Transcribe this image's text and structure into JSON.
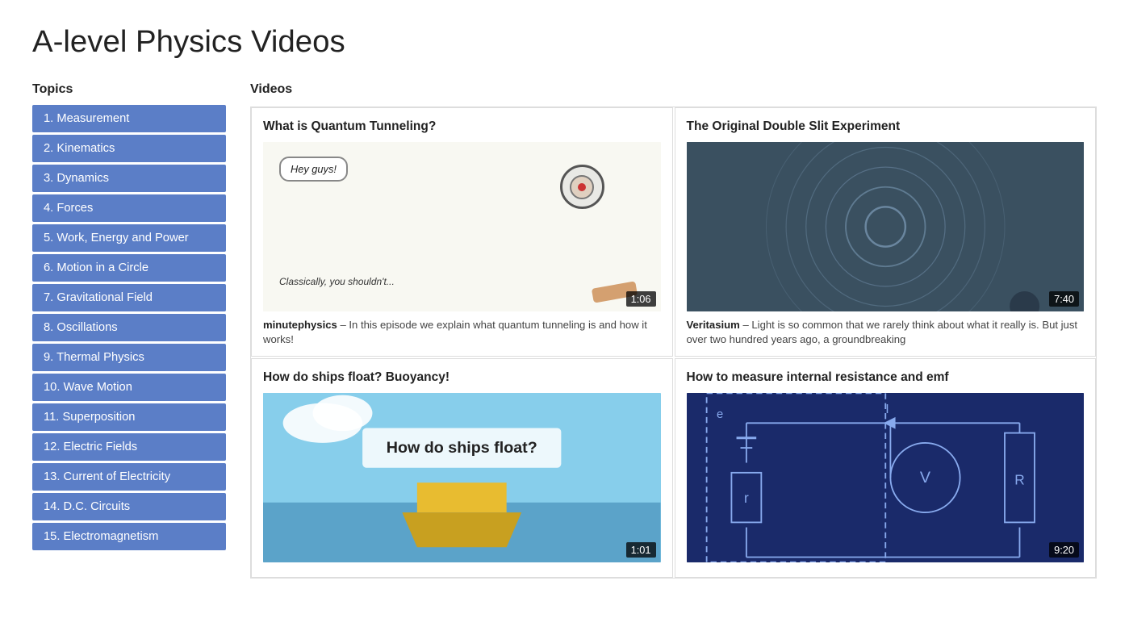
{
  "page": {
    "title": "A-level Physics Videos"
  },
  "sidebar": {
    "title": "Topics",
    "items": [
      {
        "id": "1",
        "label": "1. Measurement"
      },
      {
        "id": "2",
        "label": "2. Kinematics"
      },
      {
        "id": "3",
        "label": "3. Dynamics"
      },
      {
        "id": "4",
        "label": "4. Forces"
      },
      {
        "id": "5",
        "label": "5. Work, Energy and Power"
      },
      {
        "id": "6",
        "label": "6. Motion in a Circle"
      },
      {
        "id": "7",
        "label": "7. Gravitational Field"
      },
      {
        "id": "8",
        "label": "8. Oscillations"
      },
      {
        "id": "9",
        "label": "9. Thermal Physics"
      },
      {
        "id": "10",
        "label": "10. Wave Motion"
      },
      {
        "id": "11",
        "label": "11. Superposition"
      },
      {
        "id": "12",
        "label": "12. Electric Fields"
      },
      {
        "id": "13",
        "label": "13. Current of Electricity"
      },
      {
        "id": "14",
        "label": "14. D.C. Circuits"
      },
      {
        "id": "15",
        "label": "15. Electromagnetism"
      }
    ]
  },
  "content": {
    "title": "Videos",
    "videos": [
      {
        "id": "v1",
        "title": "What is Quantum Tunneling?",
        "channel": "minutephysics",
        "description": "In this episode we explain what quantum tunneling is and how it works!",
        "duration": "1:06",
        "thumb_type": "quantum"
      },
      {
        "id": "v2",
        "title": "The Original Double Slit Experiment",
        "channel": "Veritasium",
        "description": "Light is so common that we rarely think about what it really is. But just over two hundred years ago, a groundbreaking",
        "duration": "7:40",
        "thumb_type": "double-slit"
      },
      {
        "id": "v3",
        "title": "How do ships float? Buoyancy!",
        "channel": "",
        "description": "",
        "duration": "1:01",
        "thumb_type": "buoyancy"
      },
      {
        "id": "v4",
        "title": "How to measure internal resistance and emf",
        "channel": "",
        "description": "",
        "duration": "9:20",
        "thumb_type": "emf"
      }
    ]
  }
}
